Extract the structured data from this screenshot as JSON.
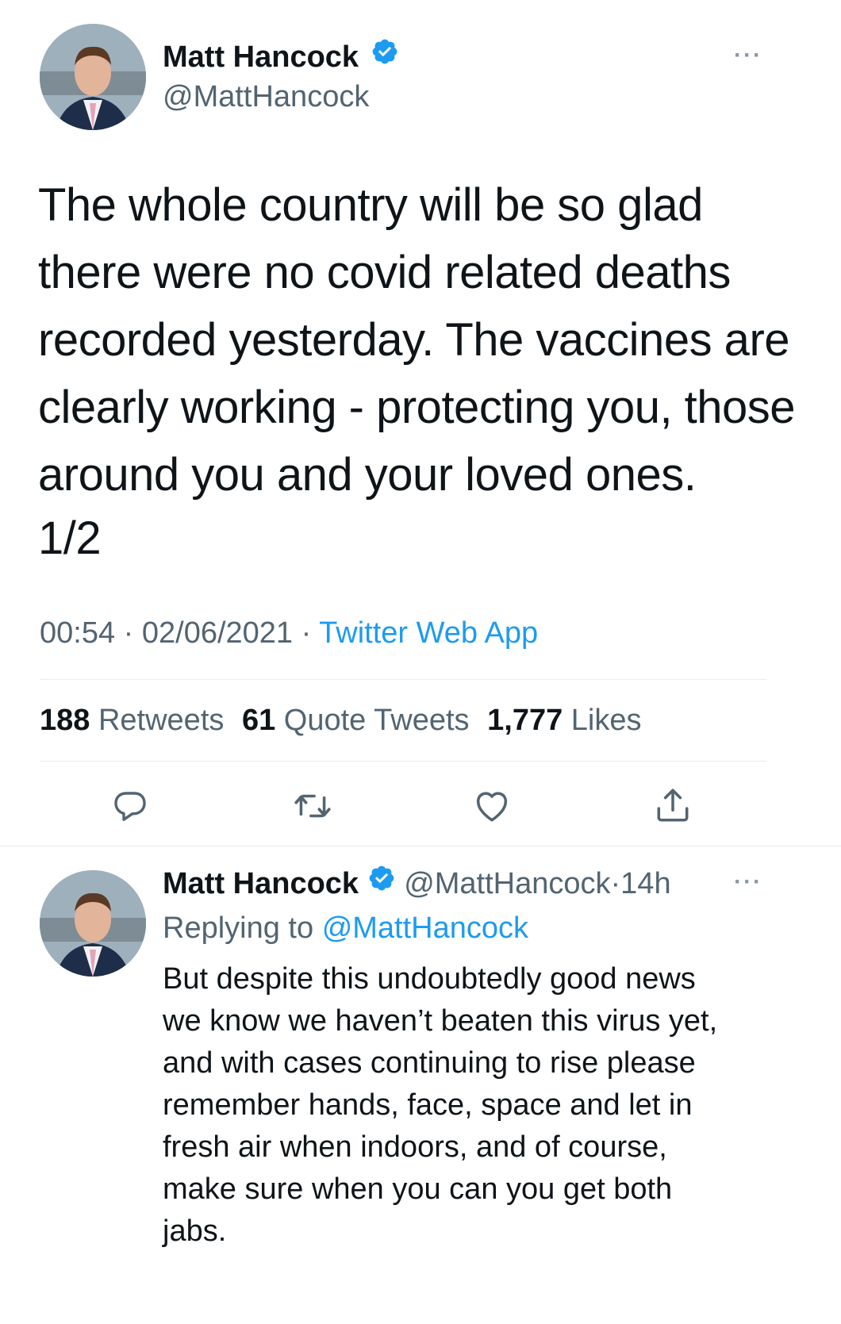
{
  "main_tweet": {
    "author_name": "Matt Hancock",
    "author_handle": "@MattHancock",
    "text_lines": [
      "The whole country will be so glad",
      "there were no covid related deaths",
      "recorded yesterday. The vaccines are",
      "clearly working - protecting you, those",
      "around you and your loved ones."
    ],
    "thread_marker": "1/2",
    "time": "00:54",
    "date": "02/06/2021",
    "source": "Twitter Web App",
    "separator": "·",
    "stats": {
      "retweets_count": "188",
      "retweets_label": "Retweets",
      "quotes_count": "61",
      "quotes_label": "Quote Tweets",
      "likes_count": "1,777",
      "likes_label": "Likes"
    },
    "more_label": "···"
  },
  "reply_tweet": {
    "author_name": "Matt Hancock",
    "author_handle": "@MattHancock",
    "separator": "·",
    "age": "14h",
    "replying_to_label": "Replying to",
    "replying_to_handle": "@MattHancock",
    "text_lines": [
      "But despite this undoubtedly good news",
      "we know we haven’t beaten this virus yet,",
      "and with cases continuing to rise please",
      "remember hands, face, space and let in",
      "fresh air when indoors, and of course,",
      "make sure when you can you get both",
      "jabs."
    ],
    "more_label": "···"
  },
  "icons": {
    "reply": "reply-icon",
    "retweet": "retweet-icon",
    "like": "heart-icon",
    "share": "share-icon",
    "verified": "verified-badge-icon"
  },
  "colors": {
    "accent": "#1d9bf0",
    "text": "#0f1419",
    "secondary": "#536471",
    "divider": "#e6ecf0"
  }
}
